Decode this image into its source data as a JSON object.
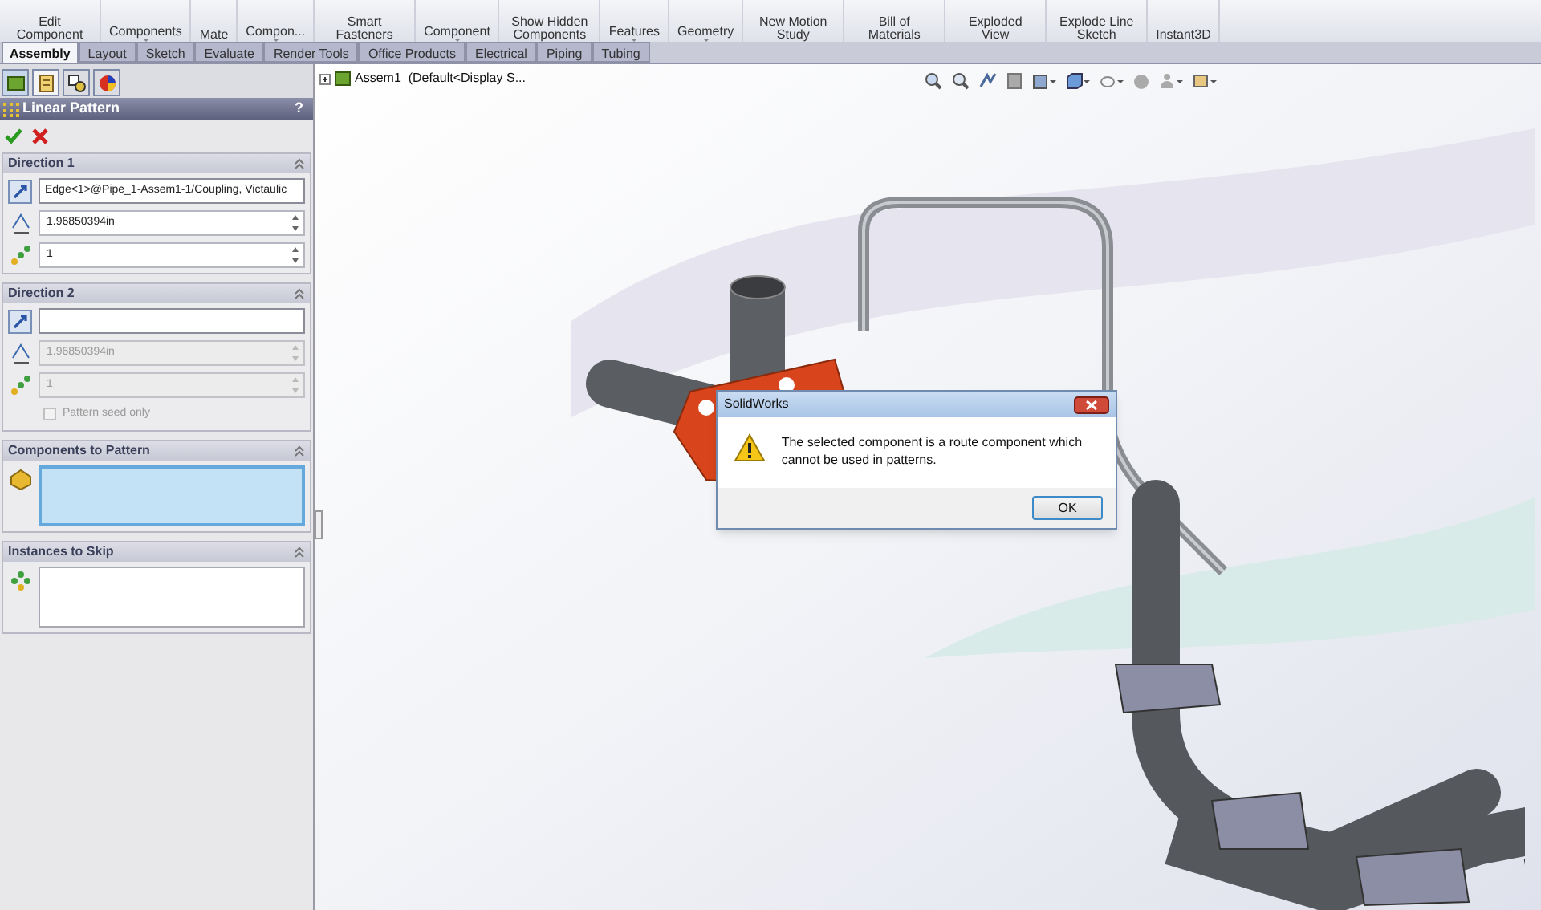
{
  "ribbon": {
    "commands": [
      {
        "label": "Edit Component",
        "dropdown": false
      },
      {
        "label": "Components",
        "dropdown": true
      },
      {
        "label": "Mate",
        "dropdown": false
      },
      {
        "label": "Compon...",
        "dropdown": true
      },
      {
        "label": "Smart Fasteners",
        "dropdown": false
      },
      {
        "label": "Component",
        "dropdown": true
      },
      {
        "label": "Show Hidden Components",
        "dropdown": false
      },
      {
        "label": "Features",
        "dropdown": true
      },
      {
        "label": "Geometry",
        "dropdown": true
      },
      {
        "label": "New Motion Study",
        "dropdown": false
      },
      {
        "label": "Bill of Materials",
        "dropdown": false
      },
      {
        "label": "Exploded View",
        "dropdown": false
      },
      {
        "label": "Explode Line Sketch",
        "dropdown": false
      },
      {
        "label": "Instant3D",
        "dropdown": false
      }
    ]
  },
  "tabs": [
    {
      "label": "Assembly",
      "selected": true
    },
    {
      "label": "Layout",
      "selected": false
    },
    {
      "label": "Sketch",
      "selected": false
    },
    {
      "label": "Evaluate",
      "selected": false
    },
    {
      "label": "Render Tools",
      "selected": false
    },
    {
      "label": "Office Products",
      "selected": false
    },
    {
      "label": "Electrical",
      "selected": false
    },
    {
      "label": "Piping",
      "selected": false
    },
    {
      "label": "Tubing",
      "selected": false
    }
  ],
  "tree": {
    "root": "Assem1  (Default<Display S..."
  },
  "property_manager": {
    "title": "Linear Pattern",
    "help": "?",
    "sections": [
      {
        "title": "Direction 1",
        "fields": [
          {
            "kind": "reference",
            "value": "Edge<1>@Pipe_1-Assem1-1/Coupling, Victaulic"
          },
          {
            "kind": "spin",
            "value": "1.96850394in",
            "disabled": false
          },
          {
            "kind": "spin",
            "value": "1",
            "disabled": false
          }
        ]
      },
      {
        "title": "Direction 2",
        "fields": [
          {
            "kind": "reference"
          },
          {
            "kind": "spin",
            "value": "1.96850394in",
            "disabled": true
          },
          {
            "kind": "spin",
            "value": "1",
            "disabled": true
          },
          {
            "kind": "checkbox",
            "label": "Pattern seed only",
            "checked": false,
            "disabled": true
          }
        ]
      },
      {
        "title": "Components to Pattern",
        "fields": [
          {
            "kind": "selection_list",
            "focused": true
          }
        ]
      },
      {
        "title": "Instances to Skip",
        "fields": [
          {
            "kind": "selection_list",
            "focused": false
          }
        ]
      }
    ]
  },
  "dialog": {
    "title": "SolidWorks",
    "message": "The selected component is a route component which cannot be used in patterns.",
    "button": "OK"
  }
}
